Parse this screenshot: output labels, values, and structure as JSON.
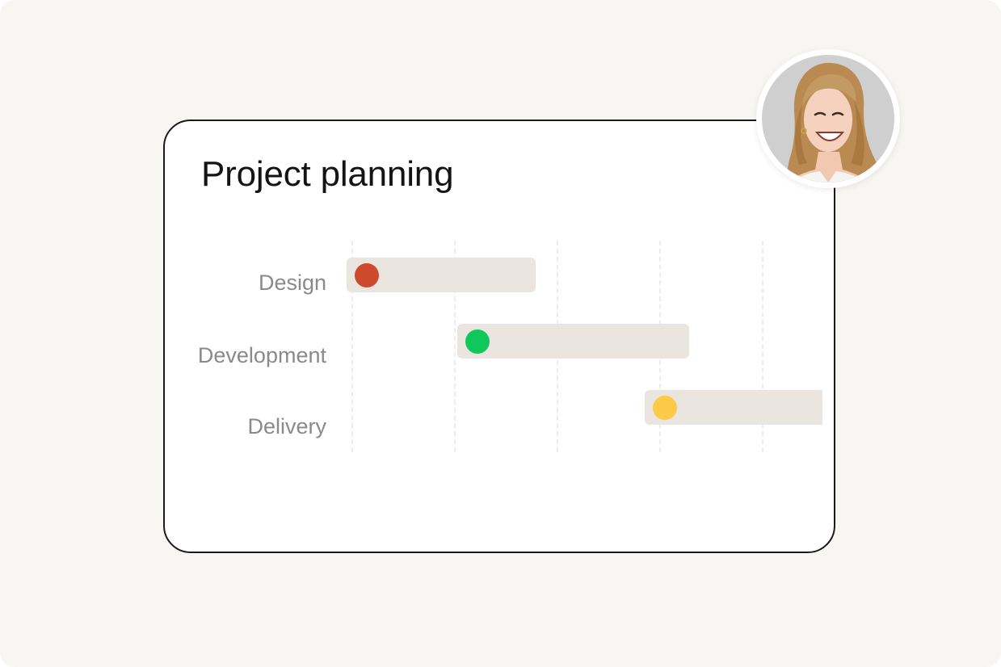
{
  "card": {
    "title": "Project planning"
  },
  "tasks": [
    {
      "label": "Design",
      "status_color": "#cf4a2c"
    },
    {
      "label": "Development",
      "status_color": "#0fc75a"
    },
    {
      "label": "Delivery",
      "status_color": "#fdca48"
    }
  ],
  "colors": {
    "page_background": "#f7f6f3",
    "card_background": "#ffffff",
    "card_border": "#1a1a1a",
    "bar_fill": "#ebe5df",
    "title_text": "#141414",
    "label_text": "#8a8a8a"
  },
  "avatar": {
    "icon": "user-avatar-photo"
  }
}
